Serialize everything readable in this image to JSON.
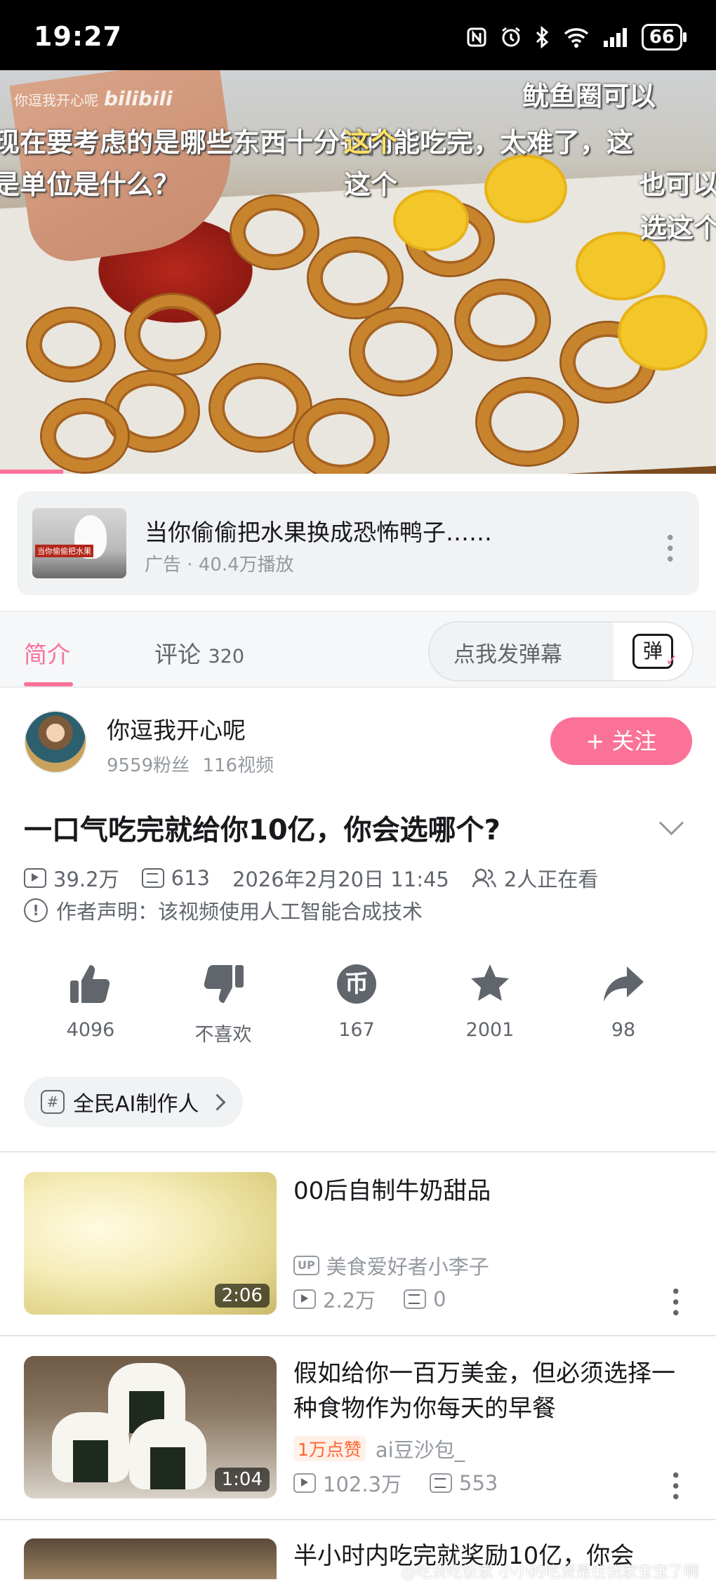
{
  "status_bar": {
    "time": "19:27",
    "battery": "66"
  },
  "video": {
    "watermark_user": "你逗我开心呢",
    "watermark_logo": "bilibili",
    "danmaku": [
      "鱿鱼圈可以",
      "现在要考虑的是哪些东西十分钟内能吃完，太难了，这",
      "这个",
      "是单位是什么？",
      "这个",
      "也可以",
      "选这个"
    ]
  },
  "ad": {
    "thumb_caption": "当你偷偷把水果",
    "title": "当你偷偷把水果换成恐怖鸭子……",
    "meta": "广告 · 40.4万播放"
  },
  "tabs": {
    "intro": "简介",
    "comments": "评论",
    "comments_count": "320",
    "danmaku_placeholder": "点我发弹幕",
    "danmaku_icon": "弹"
  },
  "uploader": {
    "name": "你逗我开心呢",
    "fans": "9559粉丝",
    "videos": "116视频",
    "follow_label": "+ 关注"
  },
  "video_info": {
    "title": "一口气吃完就给你10亿，你会选哪个?",
    "views": "39.2万",
    "danmaku_count": "613",
    "date": "2026年2月20日 11:45",
    "watching": "2人正在看",
    "declaration": "作者声明：该视频使用人工智能合成技术"
  },
  "actions": {
    "like": "4096",
    "dislike": "不喜欢",
    "coin": "167",
    "favorite": "2001",
    "share": "98",
    "coin_symbol": "币"
  },
  "tag": {
    "label": "全民AI制作人"
  },
  "recommendations": [
    {
      "title": "00后自制牛奶甜品",
      "badge": "",
      "uploader": "美食爱好者小李子",
      "views": "2.2万",
      "danmaku": "0",
      "duration": "2:06"
    },
    {
      "title": "假如给你一百万美金，但必须选择一种食物作为你每天的早餐",
      "badge": "1万点赞",
      "uploader": "ai豆沙包_",
      "views": "102.3万",
      "danmaku": "553",
      "duration": "1:04"
    },
    {
      "title": "半小时内吃完就奖励10亿，你会"
    }
  ],
  "footer_watermark": "@吃货吃饭家 小小的吃货是住我家宝宝了啊"
}
